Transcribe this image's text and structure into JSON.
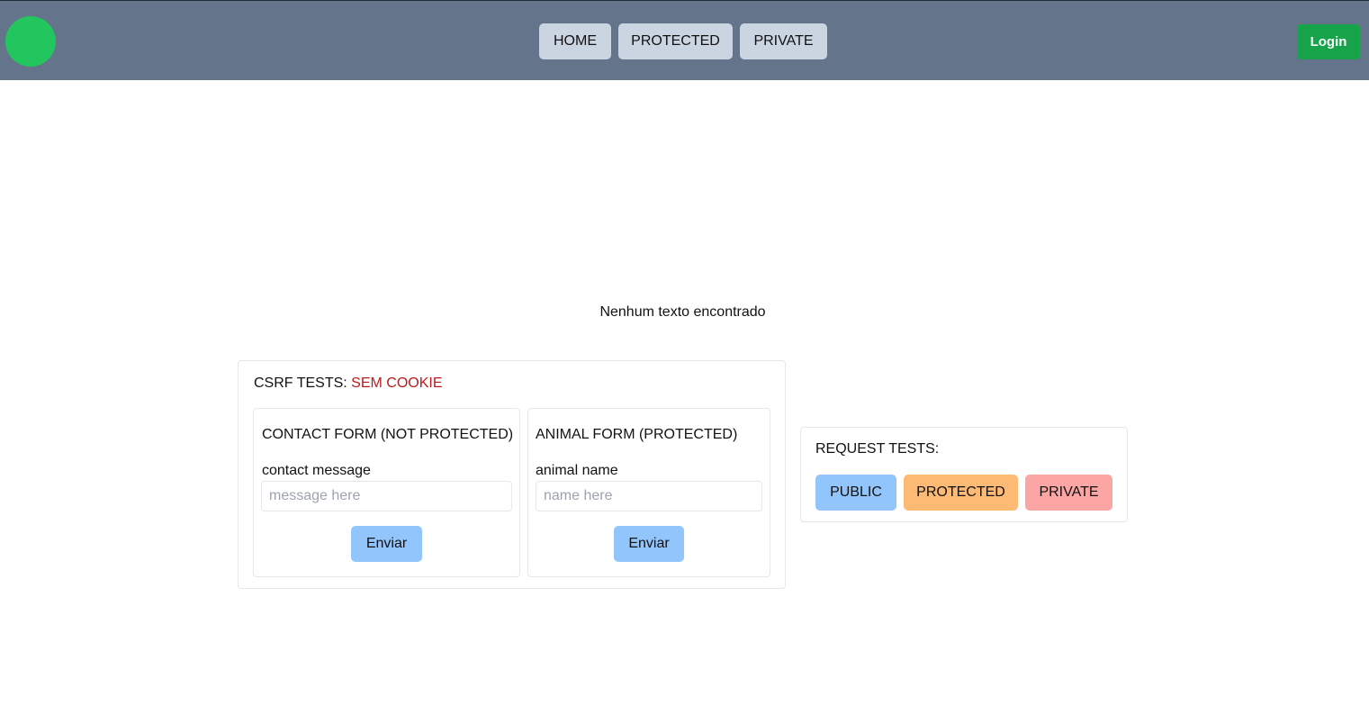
{
  "header": {
    "nav": [
      {
        "label": "HOME"
      },
      {
        "label": "PROTECTED"
      },
      {
        "label": "PRIVATE"
      }
    ],
    "login_label": "Login"
  },
  "main": {
    "empty_message": "Nenhum texto encontrado"
  },
  "csrf": {
    "title": "CSRF TESTS:",
    "status": "SEM COOKIE",
    "contact_form": {
      "title": "CONTACT FORM (NOT PROTECTED)",
      "field_label": "contact message",
      "placeholder": "message here",
      "value": "",
      "submit_label": "Enviar"
    },
    "animal_form": {
      "title": "ANIMAL FORM (PROTECTED)",
      "field_label": "animal name",
      "placeholder": "name here",
      "value": "",
      "submit_label": "Enviar"
    }
  },
  "requests": {
    "title": "REQUEST TESTS:",
    "buttons": [
      {
        "label": "PUBLIC",
        "color": "#93c5fd"
      },
      {
        "label": "PROTECTED",
        "color": "#fdba74"
      },
      {
        "label": "PRIVATE",
        "color": "#fca5a5"
      }
    ]
  },
  "colors": {
    "topbar": "#64748b",
    "logo": "#22c55e",
    "login": "#16a34a",
    "nav_button": "#cbd5e1",
    "warning": "#b91c1c"
  }
}
